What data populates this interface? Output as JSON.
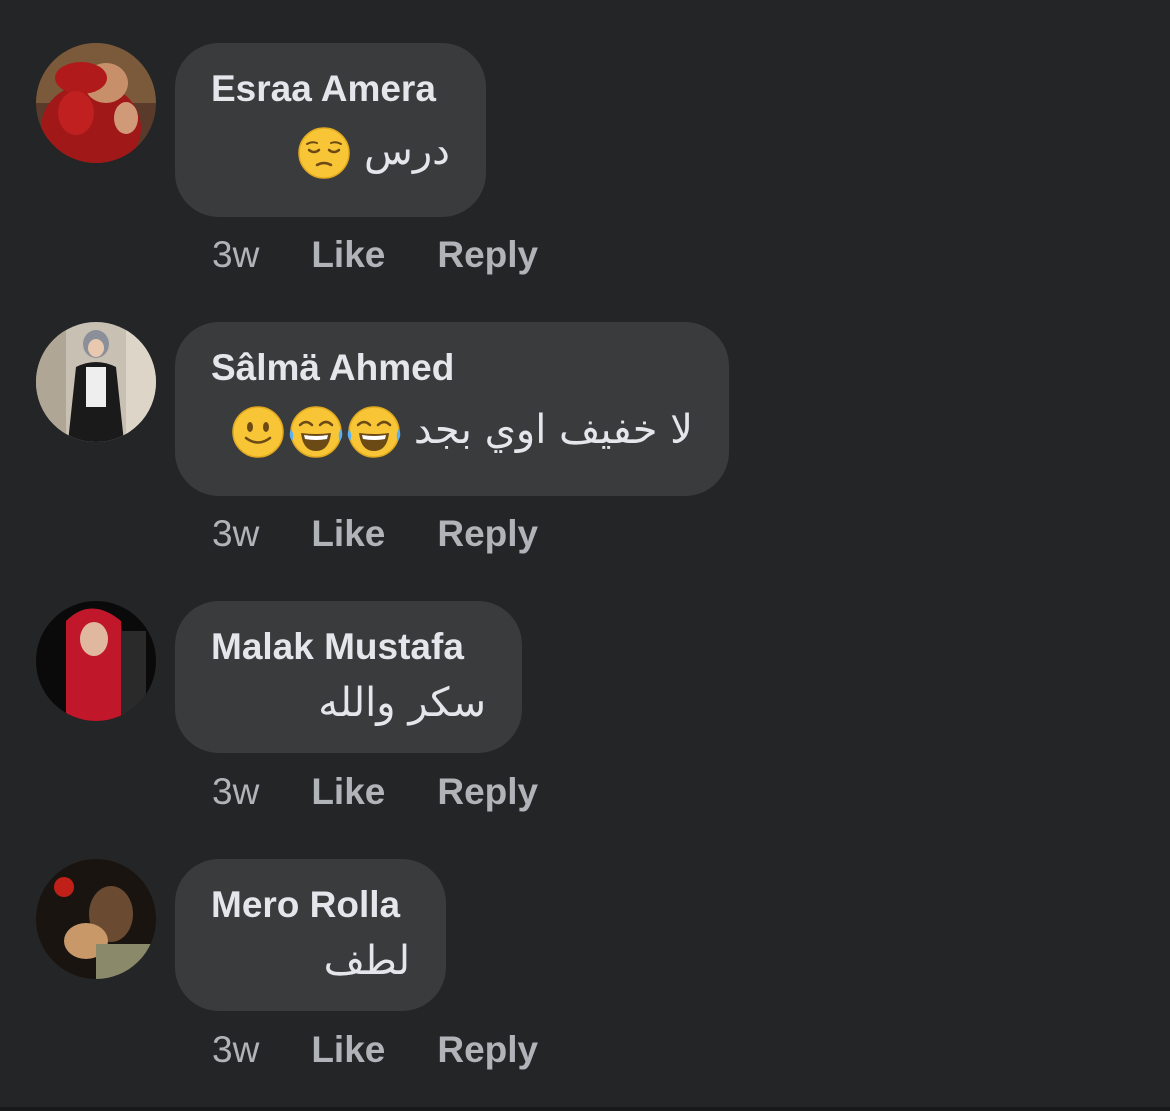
{
  "comments": [
    {
      "author": "Esraa Amera",
      "text": "درس",
      "emojis": [
        "pensive"
      ],
      "time": "3w",
      "like_label": "Like",
      "reply_label": "Reply"
    },
    {
      "author": "Sâlmä Ahmed",
      "text": "لا خفيف اوي بجد",
      "emojis": [
        "smile",
        "joy",
        "joy"
      ],
      "time": "3w",
      "like_label": "Like",
      "reply_label": "Reply"
    },
    {
      "author": "Malak Mustafa",
      "text": "سكر والله",
      "emojis": [],
      "time": "3w",
      "like_label": "Like",
      "reply_label": "Reply"
    },
    {
      "author": "Mero Rolla",
      "text": "لطف",
      "emojis": [],
      "time": "3w",
      "like_label": "Like",
      "reply_label": "Reply"
    }
  ],
  "colors": {
    "background": "#242526",
    "bubble": "#3a3b3c",
    "primary_text": "#e4e6eb",
    "secondary_text": "#b0b3b8"
  }
}
